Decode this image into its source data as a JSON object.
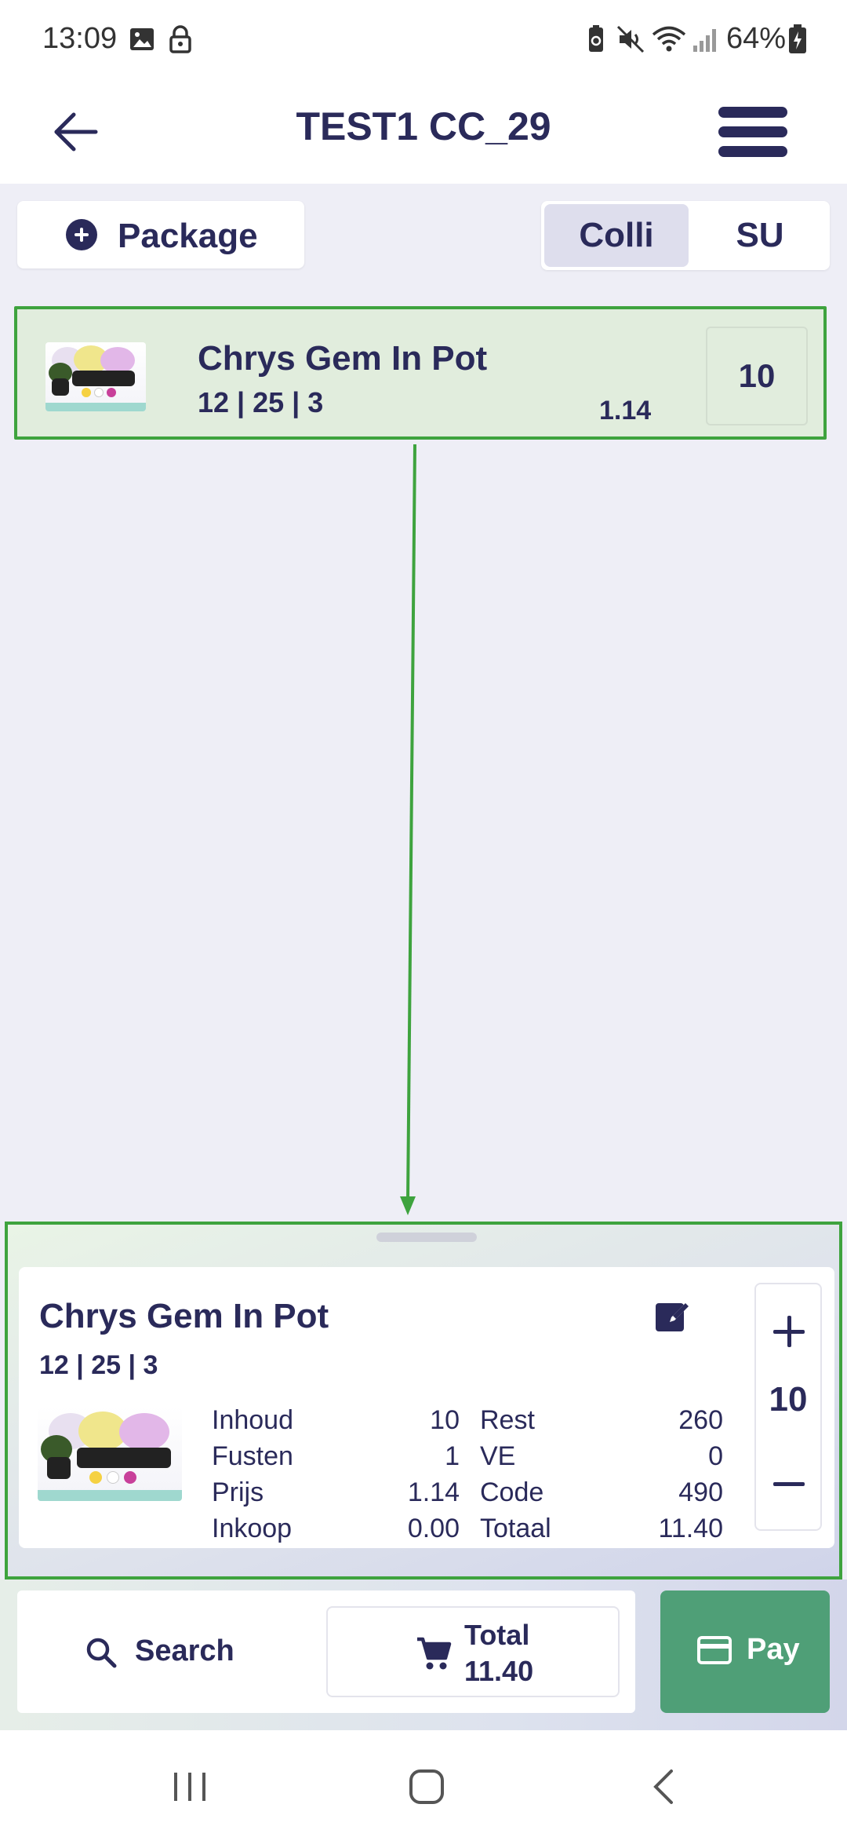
{
  "status_bar": {
    "time": "13:09",
    "battery": "64%",
    "icons": [
      "image-icon",
      "lock-icon",
      "battery-saver-icon",
      "mute-icon",
      "wifi-icon",
      "signal-icon",
      "battery-icon"
    ]
  },
  "header": {
    "title": "TEST1 CC_29",
    "back_icon": "arrow-left-icon",
    "menu_icon": "hamburger-menu-icon"
  },
  "toolbar": {
    "package_label": "Package",
    "toggle": {
      "options": [
        "Colli",
        "SU"
      ],
      "selected": "Colli"
    }
  },
  "list": {
    "items": [
      {
        "name": "Chrys Gem In Pot",
        "meta": "12 | 25 | 3",
        "price": "1.14",
        "quantity": "10",
        "selected": true
      }
    ]
  },
  "detail": {
    "name": "Chrys Gem In Pot",
    "meta": "12 | 25 | 3",
    "left": [
      {
        "label": "Inhoud",
        "value": "10"
      },
      {
        "label": "Fusten",
        "value": "1"
      },
      {
        "label": "Prijs",
        "value": "1.14"
      },
      {
        "label": "Inkoop",
        "value": "0.00"
      }
    ],
    "right": [
      {
        "label": "Rest",
        "value": "260"
      },
      {
        "label": "VE",
        "value": "0"
      },
      {
        "label": "Code",
        "value": "490"
      },
      {
        "label": "Totaal",
        "value": "11.40"
      }
    ],
    "stepper_value": "10"
  },
  "bottom": {
    "search_label": "Search",
    "total_label": "Total",
    "total_value": "11.40",
    "pay_label": "Pay"
  },
  "colors": {
    "primary": "#2a2a5a",
    "highlight_border": "#3ea33e",
    "selected_row_bg": "#e1eddd",
    "pay_button": "#4f9f77",
    "background": "#eeeef6"
  }
}
